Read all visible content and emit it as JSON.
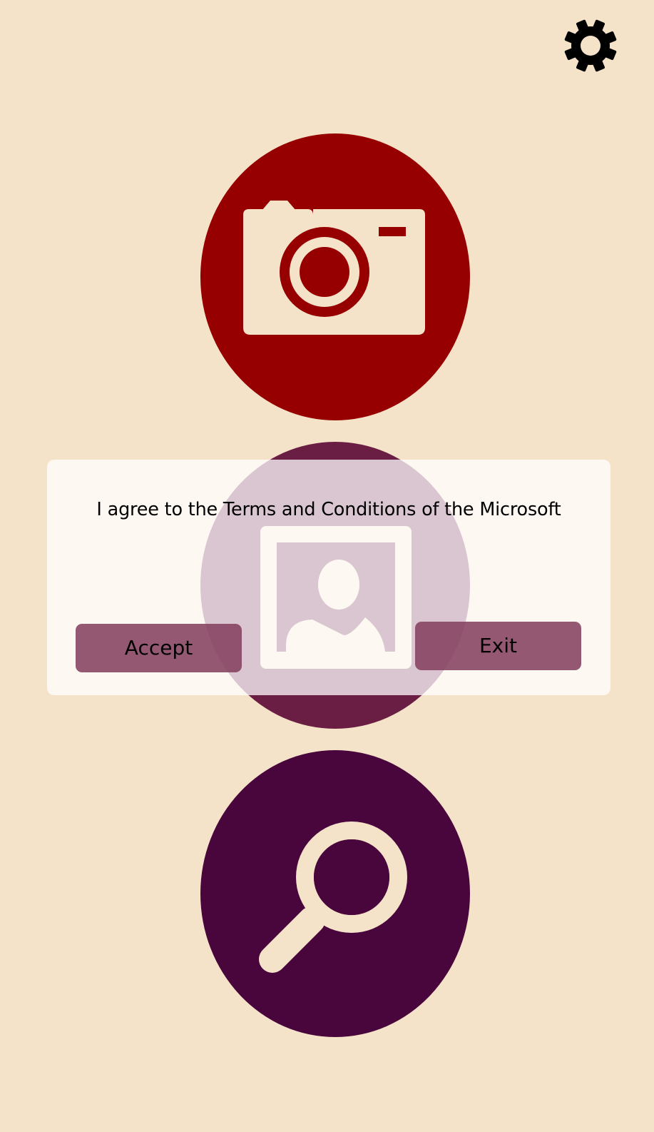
{
  "colors": {
    "background": "#f5e3c9",
    "camera_circle": "#970000",
    "portrait_circle": "#6b1e44",
    "search_circle": "#48063d",
    "icon_fill": "#f5e3c9",
    "settings_icon": "#000000",
    "dialog_background": "rgba(255,255,255,0.75)",
    "dialog_button": "rgba(133,65,97,0.88)",
    "text": "#000000"
  },
  "header": {
    "settings_icon": "gear-icon"
  },
  "main": {
    "buttons": [
      {
        "icon": "camera-icon"
      },
      {
        "icon": "portrait-icon"
      },
      {
        "icon": "search-icon"
      }
    ]
  },
  "dialog": {
    "message": "I agree to the Terms and Conditions of the Microsoft",
    "accept_label": "Accept",
    "exit_label": "Exit"
  }
}
